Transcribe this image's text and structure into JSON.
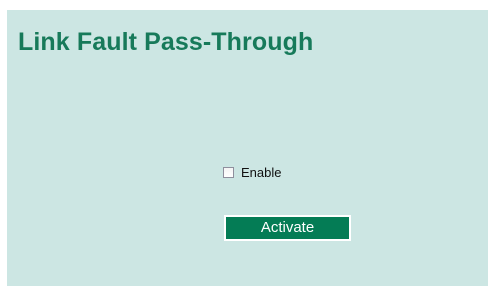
{
  "page": {
    "title": "Link Fault Pass-Through"
  },
  "settings": {
    "enable": {
      "label": "Enable",
      "checked": false
    }
  },
  "actions": {
    "activate_label": "Activate"
  },
  "colors": {
    "panel_background": "#cce6e3",
    "title_color": "#177a5a",
    "button_background": "#047c55",
    "button_text": "#ffffff"
  }
}
